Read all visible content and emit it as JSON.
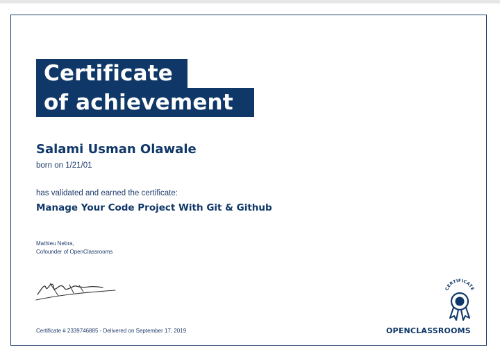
{
  "certificate": {
    "title_line1": "Certificate",
    "title_line2": "of achievement",
    "recipient_name": "Salami Usman Olawale",
    "birth_line": "born on 1/21/01",
    "validated_text": "has validated and earned the certificate:",
    "course_title": "Manage Your Code Project With Git & Github",
    "signer_name": "Mathieu Nebra,",
    "signer_role": "Cofounder of OpenClassrooms",
    "certificate_line": "Certificate # 2339746885 - Delivered on September 17, 2019",
    "badge_text": "CERTIFICATE",
    "brand_name": "OPENCLASSROOMS"
  },
  "colors": {
    "navy": "#0f3767",
    "text": "#1f3b6a",
    "background": "#ffffff"
  },
  "icons": {
    "signature": "signature-mark",
    "badge": "certificate-rosette-icon"
  }
}
